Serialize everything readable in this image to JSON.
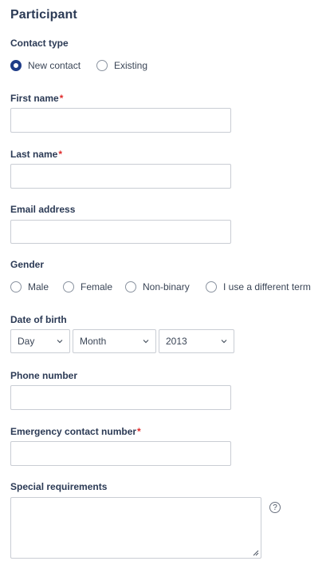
{
  "section": {
    "title": "Participant"
  },
  "contact_type": {
    "label": "Contact type",
    "options": [
      {
        "label": "New contact",
        "checked": true
      },
      {
        "label": "Existing",
        "checked": false
      }
    ]
  },
  "first_name": {
    "label": "First name",
    "required": "*",
    "value": ""
  },
  "last_name": {
    "label": "Last name",
    "required": "*",
    "value": ""
  },
  "email": {
    "label": "Email address",
    "value": ""
  },
  "gender": {
    "label": "Gender",
    "options": [
      "Male",
      "Female",
      "Non-binary",
      "I use a different term"
    ]
  },
  "dob": {
    "label": "Date of birth",
    "day": "Day",
    "month": "Month",
    "year": "2013"
  },
  "phone": {
    "label": "Phone number",
    "value": ""
  },
  "emergency": {
    "label": "Emergency contact number",
    "required": "*",
    "value": ""
  },
  "special": {
    "label": "Special requirements",
    "value": "",
    "help_icon": "question-circle-icon"
  },
  "colors": {
    "text": "#2b3a55",
    "required": "#e02b2b",
    "radio_checked": "#1f3c88",
    "border": "#c9cdd4"
  }
}
